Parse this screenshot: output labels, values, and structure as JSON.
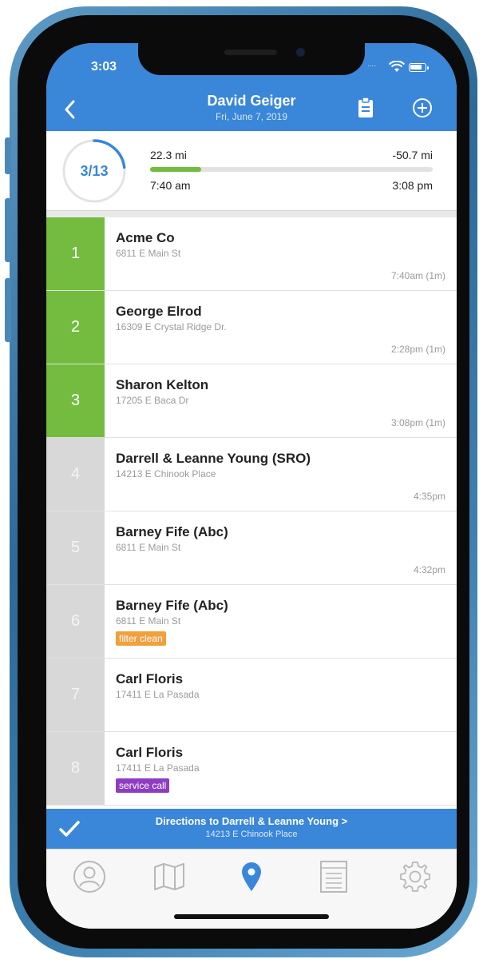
{
  "status_bar": {
    "time": "3:03",
    "dots": "...."
  },
  "header": {
    "title": "David Geiger",
    "subtitle": "Fri, June 7, 2019",
    "icons": {
      "back": "chevron-left-icon",
      "clipboard": "clipboard-icon",
      "add": "plus-circle-icon"
    }
  },
  "summary": {
    "progress_label": "3/13",
    "progress_fraction": 0.23,
    "distance_done": "22.3 mi",
    "distance_remaining": "-50.7 mi",
    "bar_fraction": 0.18,
    "start_time": "7:40 am",
    "end_time": "3:08 pm"
  },
  "colors": {
    "accent": "#3a86d8",
    "done": "#73bc3f",
    "pending": "#d8d8d8",
    "tag_orange": "#f0a03c",
    "tag_purple": "#8e3cc2"
  },
  "stops": [
    {
      "number": "1",
      "name": "Acme Co",
      "address": "6811 E Main St",
      "time": "7:40am (1m)",
      "status": "done"
    },
    {
      "number": "2",
      "name": "George Elrod",
      "address": "16309 E Crystal Ridge Dr.",
      "time": "2:28pm (1m)",
      "status": "done"
    },
    {
      "number": "3",
      "name": "Sharon Kelton",
      "address": "17205 E Baca Dr",
      "time": "3:08pm (1m)",
      "status": "done"
    },
    {
      "number": "4",
      "name": "Darrell & Leanne Young (SRO)",
      "address": "14213 E Chinook Place",
      "time": "4:35pm",
      "status": "pending"
    },
    {
      "number": "5",
      "name": "Barney Fife (Abc)",
      "address": "6811 E Main St",
      "time": "4:32pm",
      "status": "pending"
    },
    {
      "number": "6",
      "name": "Barney Fife (Abc)",
      "address": "6811 E Main St",
      "time": "",
      "tag": "filter clean",
      "tag_color": "#f0a03c",
      "status": "pending"
    },
    {
      "number": "7",
      "name": "Carl Floris",
      "address": "17411 E La Pasada",
      "time": "",
      "status": "pending"
    },
    {
      "number": "8",
      "name": "Carl Floris",
      "address": "17411 E La Pasada",
      "time": "",
      "tag": "service call",
      "tag_color": "#8e3cc2",
      "status": "pending"
    }
  ],
  "directions": {
    "title": "Directions to Darrell & Leanne Young >",
    "address": "14213 E Chinook Place"
  },
  "tab_bar": {
    "tabs": [
      {
        "icon": "person-icon",
        "active": false
      },
      {
        "icon": "map-icon",
        "active": false
      },
      {
        "icon": "location-pin-icon",
        "active": true
      },
      {
        "icon": "list-icon",
        "active": false
      },
      {
        "icon": "gear-icon",
        "active": false
      }
    ]
  }
}
